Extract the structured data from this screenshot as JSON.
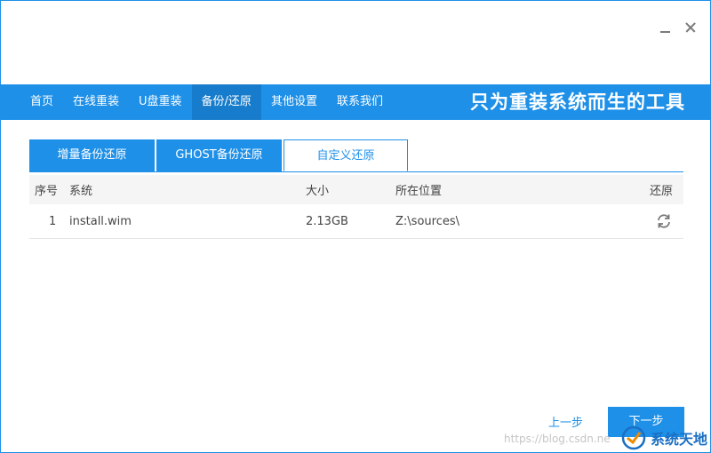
{
  "nav": {
    "items": [
      {
        "label": "首页"
      },
      {
        "label": "在线重装"
      },
      {
        "label": "U盘重装"
      },
      {
        "label": "备份/还原"
      },
      {
        "label": "其他设置"
      },
      {
        "label": "联系我们"
      }
    ],
    "active_index": 3,
    "slogan": "只为重装系统而生的工具"
  },
  "tabs": [
    {
      "label": "增量备份还原"
    },
    {
      "label": "GHOST备份还原"
    },
    {
      "label": "自定义还原"
    }
  ],
  "active_tab": 2,
  "table": {
    "headers": {
      "index": "序号",
      "system": "系统",
      "size": "大小",
      "location": "所在位置",
      "action": "还原"
    },
    "rows": [
      {
        "index": "1",
        "system": "install.wim",
        "size": "2.13GB",
        "location": "Z:\\sources\\"
      }
    ]
  },
  "footer": {
    "prev_label": "上一步",
    "next_label": "下一步",
    "watermark": "https://blog.csdn.ne",
    "site_name": "系统天地"
  },
  "colors": {
    "accent": "#1e90e8",
    "accent_dark": "#177ccb"
  },
  "icons": {
    "restore": "refresh-icon",
    "minimize": "minimize-icon",
    "close": "close-icon"
  }
}
